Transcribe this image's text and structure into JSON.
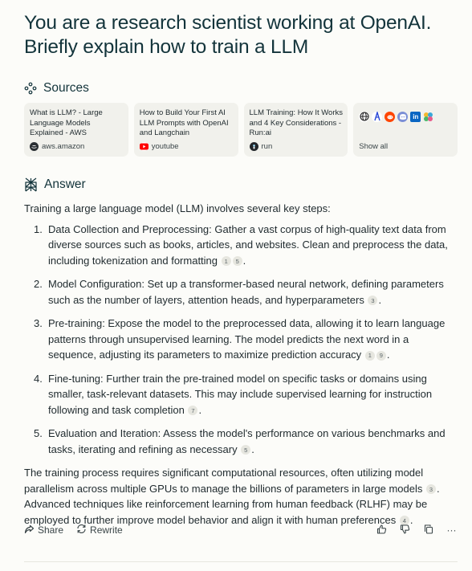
{
  "query": "You are a research scientist working at OpenAI. Briefly explain how to train a LLM",
  "sources": {
    "heading": "Sources",
    "cards": [
      {
        "title": "What is LLM? - Large Language Models Explained - AWS",
        "site": "aws.amazon"
      },
      {
        "title": "How to Build Your First AI LLM Prompts with OpenAI and Langchain",
        "site": "youtube"
      },
      {
        "title": "LLM Training: How It Works and 4 Key Considerations - Run:ai",
        "site": "run"
      }
    ],
    "show_all": "Show all",
    "show_all_icons": [
      "globe-icon",
      "perplexity-icon",
      "reddit-icon",
      "discord-icon",
      "linkedin-icon",
      "logo-icon"
    ]
  },
  "answer": {
    "heading": "Answer",
    "intro": "Training a large language model (LLM) involves several key steps:",
    "steps": [
      {
        "num": "1.",
        "text": "Data Collection and Preprocessing: Gather a vast corpus of high-quality text data from diverse sources such as books, articles, and websites. Clean and preprocess the data, including tokenization and formatting",
        "cites": [
          "1",
          "5"
        ],
        "end": "."
      },
      {
        "num": "2.",
        "text": "Model Configuration: Set up a transformer-based neural network, defining parameters such as the number of layers, attention heads, and hyperparameters",
        "cites": [
          "3"
        ],
        "end": "."
      },
      {
        "num": "3.",
        "text": "Pre-training: Expose the model to the preprocessed data, allowing it to learn language patterns through unsupervised learning. The model predicts the next word in a sequence, adjusting its parameters to maximize prediction accuracy",
        "cites": [
          "1",
          "9"
        ],
        "end": "."
      },
      {
        "num": "4.",
        "text": "Fine-tuning: Further train the pre-trained model on specific tasks or domains using smaller, task-relevant datasets. This may include supervised learning for instruction following and task completion",
        "cites": [
          "7"
        ],
        "end": "."
      },
      {
        "num": "5.",
        "text": "Evaluation and Iteration: Assess the model's performance on various benchmarks and tasks, iterating and refining as necessary",
        "cites": [
          "5"
        ],
        "end": "."
      }
    ],
    "closing_1": "The training process requires significant computational resources, often utilizing model parallelism across multiple GPUs to manage the billions of parameters in large models",
    "closing_1_cite": "3",
    "closing_2": ". Advanced techniques like reinforcement learning from human feedback (RLHF) may be employed to further improve model behavior and align it with human preferences",
    "closing_2_cite": "4",
    "closing_end": "."
  },
  "toolbar": {
    "share": "Share",
    "rewrite": "Rewrite",
    "more": "···"
  },
  "colors": {
    "background": "#fcfcf9",
    "card": "#f1f1ec",
    "text": "#13343b"
  }
}
